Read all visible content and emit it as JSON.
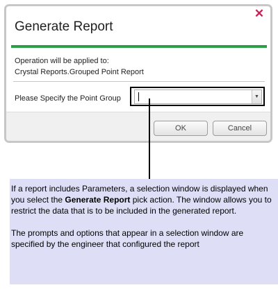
{
  "dialog": {
    "title": "Generate Report",
    "close_glyph": "✕",
    "operation_label": "Operation will be applied to:",
    "operation_target": "Crystal Reports.Grouped Point Report",
    "field_label": "Please Specify the Point Group",
    "field_value": "",
    "accent_color": "#2aa148",
    "buttons": {
      "ok": "OK",
      "cancel": "Cancel"
    }
  },
  "callout": {
    "p1_before": "If a report includes Parameters, a selection window is displayed when you select the ",
    "p1_bold": "Generate Report",
    "p1_after": " pick action. The window allows you to restrict the data that is to be included in the generated report.",
    "p2": "The prompts and options that appear in a selection window are specified by the engineer that configured the report"
  }
}
